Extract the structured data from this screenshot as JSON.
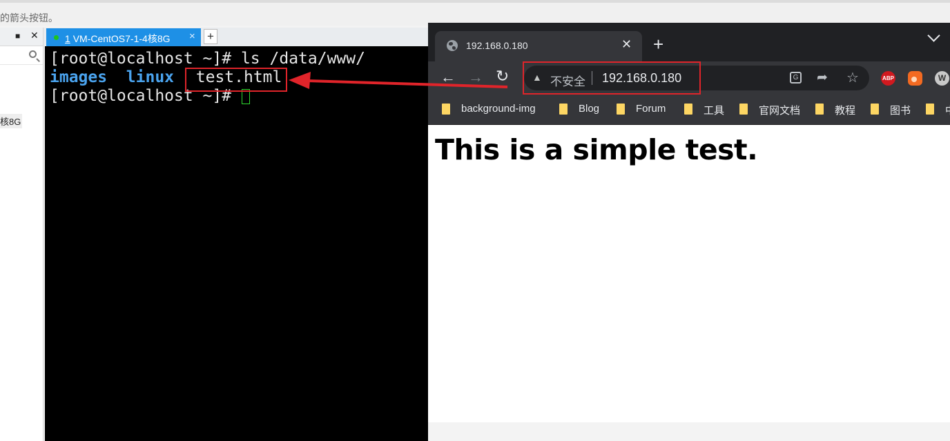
{
  "top_hint": {
    "text": "的箭头按钮。"
  },
  "left_panel": {
    "pin_glyph": "ꟹ",
    "close_glyph": "✕",
    "session_label": "核8G"
  },
  "terminal_tabs": {
    "active_tab": {
      "number": "1",
      "title": "VM-CentOS7-1-4核8G",
      "close": "×"
    },
    "add_label": "+"
  },
  "terminal": {
    "lines": [
      {
        "prompt": "[root@localhost ~]# ",
        "command": "ls /data/www/"
      },
      {
        "entries": [
          "images",
          "linux",
          "test.html"
        ]
      },
      {
        "prompt": "[root@localhost ~]# "
      }
    ]
  },
  "browser": {
    "tab": {
      "title": "192.168.0.180",
      "close": "✕"
    },
    "new_tab": "+",
    "address_bar": {
      "security_label": "不安全",
      "url": "192.168.0.180"
    },
    "extensions": {
      "abp": "ABP",
      "w": "W"
    },
    "bookmarks": [
      "background-img",
      "Blog",
      "Forum",
      "工具",
      "官网文档",
      "教程",
      "图书",
      "中"
    ],
    "page": {
      "heading": "This is a simple test."
    }
  },
  "colors": {
    "annotation_red": "#e0242a",
    "terminal_dir_blue": "#4aa3ee",
    "tab_blue": "#1e90e6",
    "chrome_dark": "#202124"
  }
}
